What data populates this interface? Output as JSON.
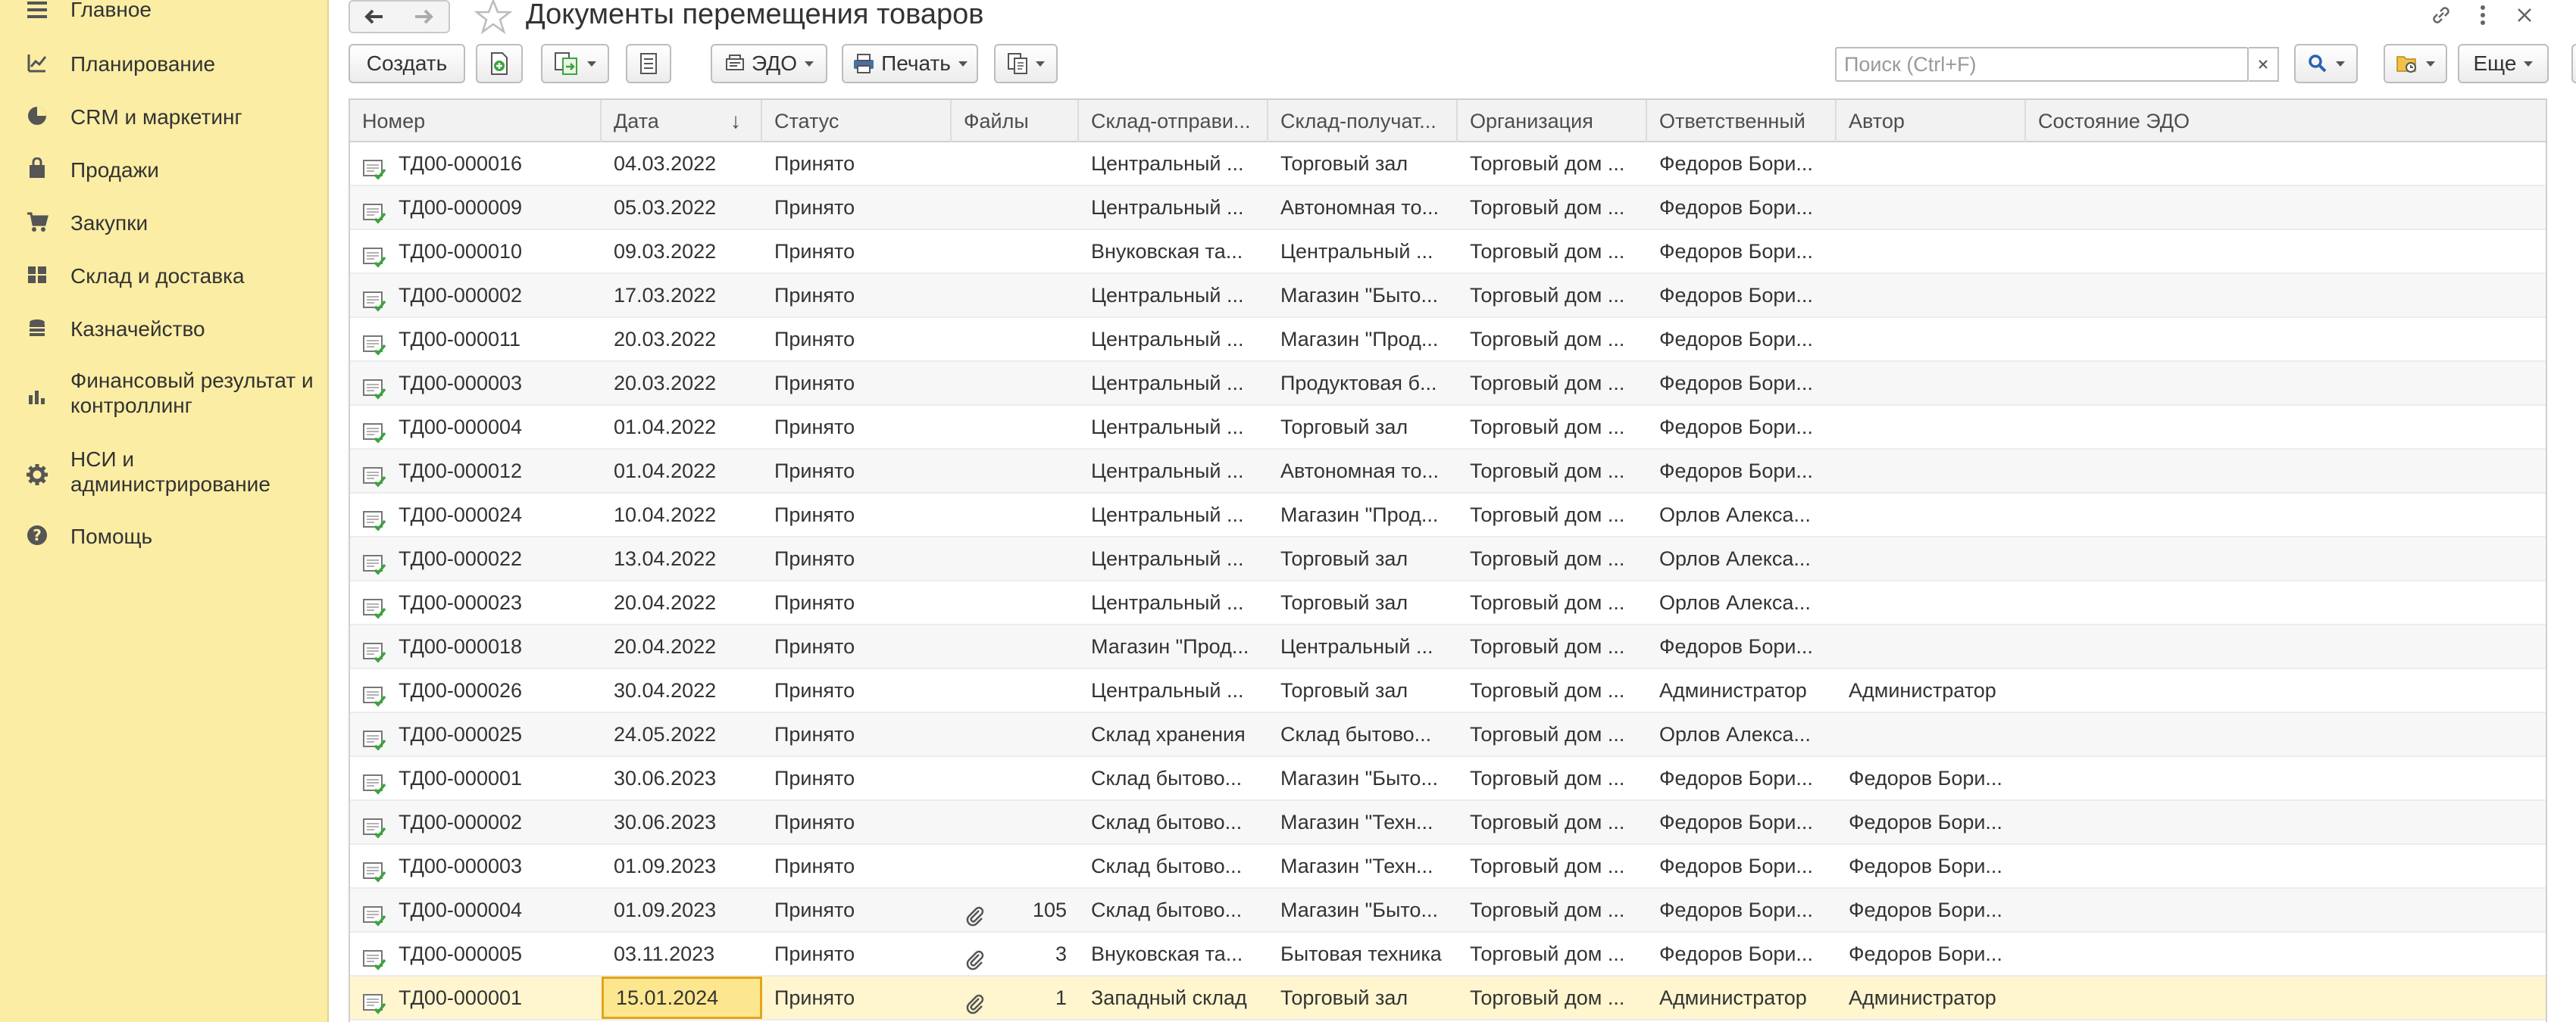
{
  "sidebar": {
    "items": [
      {
        "label": "Главное",
        "icon": "menu-icon"
      },
      {
        "label": "Планирование",
        "icon": "planning-icon"
      },
      {
        "label": "CRM и маркетинг",
        "icon": "crm-pie-icon"
      },
      {
        "label": "Продажи",
        "icon": "bag-icon"
      },
      {
        "label": "Закупки",
        "icon": "cart-icon"
      },
      {
        "label": "Склад и доставка",
        "icon": "warehouse-grid-icon"
      },
      {
        "label": "Казначейство",
        "icon": "coins-icon"
      },
      {
        "label": "Финансовый результат и",
        "label2": "контроллинг",
        "icon": "bar-chart-icon"
      },
      {
        "label": "НСИ и",
        "label2": "администрирование",
        "icon": "gear-icon"
      },
      {
        "label": "Помощь",
        "icon": "help-icon"
      }
    ]
  },
  "header": {
    "title": "Документы перемещения товаров"
  },
  "toolbar": {
    "create_label": "Создать",
    "edo_label": "ЭДО",
    "print_label": "Печать",
    "more_label": "Еще",
    "help_label": "?"
  },
  "search": {
    "placeholder": "Поиск (Ctrl+F)",
    "value": ""
  },
  "table": {
    "columns": [
      "Номер",
      "Дата",
      "Статус",
      "Файлы",
      "Склад-отправи...",
      "Склад-получат...",
      "Организация",
      "Ответственный",
      "Автор",
      "Состояние ЭДО"
    ],
    "rows": [
      {
        "num": "ТД00-000016",
        "date": "04.03.2022",
        "status": "Принято",
        "files": "",
        "from": "Центральный ...",
        "to": "Торговый зал",
        "org": "Торговый дом ...",
        "resp": "Федоров Бори...",
        "author": ""
      },
      {
        "num": "ТД00-000009",
        "date": "05.03.2022",
        "status": "Принято",
        "files": "",
        "from": "Центральный ...",
        "to": "Автономная то...",
        "org": "Торговый дом ...",
        "resp": "Федоров Бори...",
        "author": ""
      },
      {
        "num": "ТД00-000010",
        "date": "09.03.2022",
        "status": "Принято",
        "files": "",
        "from": "Внуковская та...",
        "to": "Центральный ...",
        "org": "Торговый дом ...",
        "resp": "Федоров Бори...",
        "author": ""
      },
      {
        "num": "ТД00-000002",
        "date": "17.03.2022",
        "status": "Принято",
        "files": "",
        "from": "Центральный ...",
        "to": "Магазин \"Быто...",
        "org": "Торговый дом ...",
        "resp": "Федоров Бори...",
        "author": ""
      },
      {
        "num": "ТД00-000011",
        "date": "20.03.2022",
        "status": "Принято",
        "files": "",
        "from": "Центральный ...",
        "to": "Магазин \"Прод...",
        "org": "Торговый дом ...",
        "resp": "Федоров Бори...",
        "author": ""
      },
      {
        "num": "ТД00-000003",
        "date": "20.03.2022",
        "status": "Принято",
        "files": "",
        "from": "Центральный ...",
        "to": "Продуктовая б...",
        "org": "Торговый дом ...",
        "resp": "Федоров Бори...",
        "author": ""
      },
      {
        "num": "ТД00-000004",
        "date": "01.04.2022",
        "status": "Принято",
        "files": "",
        "from": "Центральный ...",
        "to": "Торговый зал",
        "org": "Торговый дом ...",
        "resp": "Федоров Бори...",
        "author": ""
      },
      {
        "num": "ТД00-000012",
        "date": "01.04.2022",
        "status": "Принято",
        "files": "",
        "from": "Центральный ...",
        "to": "Автономная то...",
        "org": "Торговый дом ...",
        "resp": "Федоров Бори...",
        "author": ""
      },
      {
        "num": "ТД00-000024",
        "date": "10.04.2022",
        "status": "Принято",
        "files": "",
        "from": "Центральный ...",
        "to": "Магазин \"Прод...",
        "org": "Торговый дом ...",
        "resp": "Орлов Алекса...",
        "author": ""
      },
      {
        "num": "ТД00-000022",
        "date": "13.04.2022",
        "status": "Принято",
        "files": "",
        "from": "Центральный ...",
        "to": "Торговый зал",
        "org": "Торговый дом ...",
        "resp": "Орлов Алекса...",
        "author": ""
      },
      {
        "num": "ТД00-000023",
        "date": "20.04.2022",
        "status": "Принято",
        "files": "",
        "from": "Центральный ...",
        "to": "Торговый зал",
        "org": "Торговый дом ...",
        "resp": "Орлов Алекса...",
        "author": ""
      },
      {
        "num": "ТД00-000018",
        "date": "20.04.2022",
        "status": "Принято",
        "files": "",
        "from": "Магазин \"Прод...",
        "to": "Центральный ...",
        "org": "Торговый дом ...",
        "resp": "Федоров Бори...",
        "author": ""
      },
      {
        "num": "ТД00-000026",
        "date": "30.04.2022",
        "status": "Принято",
        "files": "",
        "from": "Центральный ...",
        "to": "Торговый зал",
        "org": "Торговый дом ...",
        "resp": "Администратор",
        "author": "Администратор"
      },
      {
        "num": "ТД00-000025",
        "date": "24.05.2022",
        "status": "Принято",
        "files": "",
        "from": "Склад хранения",
        "to": "Склад бытово...",
        "org": "Торговый дом ...",
        "resp": "Орлов Алекса...",
        "author": ""
      },
      {
        "num": "ТД00-000001",
        "date": "30.06.2023",
        "status": "Принято",
        "files": "",
        "from": "Склад бытово...",
        "to": "Магазин \"Быто...",
        "org": "Торговый дом ...",
        "resp": "Федоров Бори...",
        "author": "Федоров Бори..."
      },
      {
        "num": "ТД00-000002",
        "date": "30.06.2023",
        "status": "Принято",
        "files": "",
        "from": "Склад бытово...",
        "to": "Магазин \"Техн...",
        "org": "Торговый дом ...",
        "resp": "Федоров Бори...",
        "author": "Федоров Бори..."
      },
      {
        "num": "ТД00-000003",
        "date": "01.09.2023",
        "status": "Принято",
        "files": "",
        "from": "Склад бытово...",
        "to": "Магазин \"Техн...",
        "org": "Торговый дом ...",
        "resp": "Федоров Бори...",
        "author": "Федоров Бори..."
      },
      {
        "num": "ТД00-000004",
        "date": "01.09.2023",
        "status": "Принято",
        "files": "105",
        "from": "Склад бытово...",
        "to": "Магазин \"Быто...",
        "org": "Торговый дом ...",
        "resp": "Федоров Бори...",
        "author": "Федоров Бори..."
      },
      {
        "num": "ТД00-000005",
        "date": "03.11.2023",
        "status": "Принято",
        "files": "3",
        "from": "Внуковская та...",
        "to": "Бытовая техника",
        "org": "Торговый дом ...",
        "resp": "Федоров Бори...",
        "author": "Федоров Бори..."
      },
      {
        "num": "ТД00-000001",
        "date": "15.01.2024",
        "status": "Принято",
        "files": "1",
        "from": "Западный склад",
        "to": "Торговый зал",
        "org": "Торговый дом ...",
        "resp": "Администратор",
        "author": "Администратор"
      }
    ],
    "selected_row": 19
  },
  "colors": {
    "sidebar_bg": "#fbeda4",
    "selected_row_bg": "#fff6cf",
    "selected_cell_border": "#e3a41c",
    "doc_icon_green": "#3aa53a"
  }
}
